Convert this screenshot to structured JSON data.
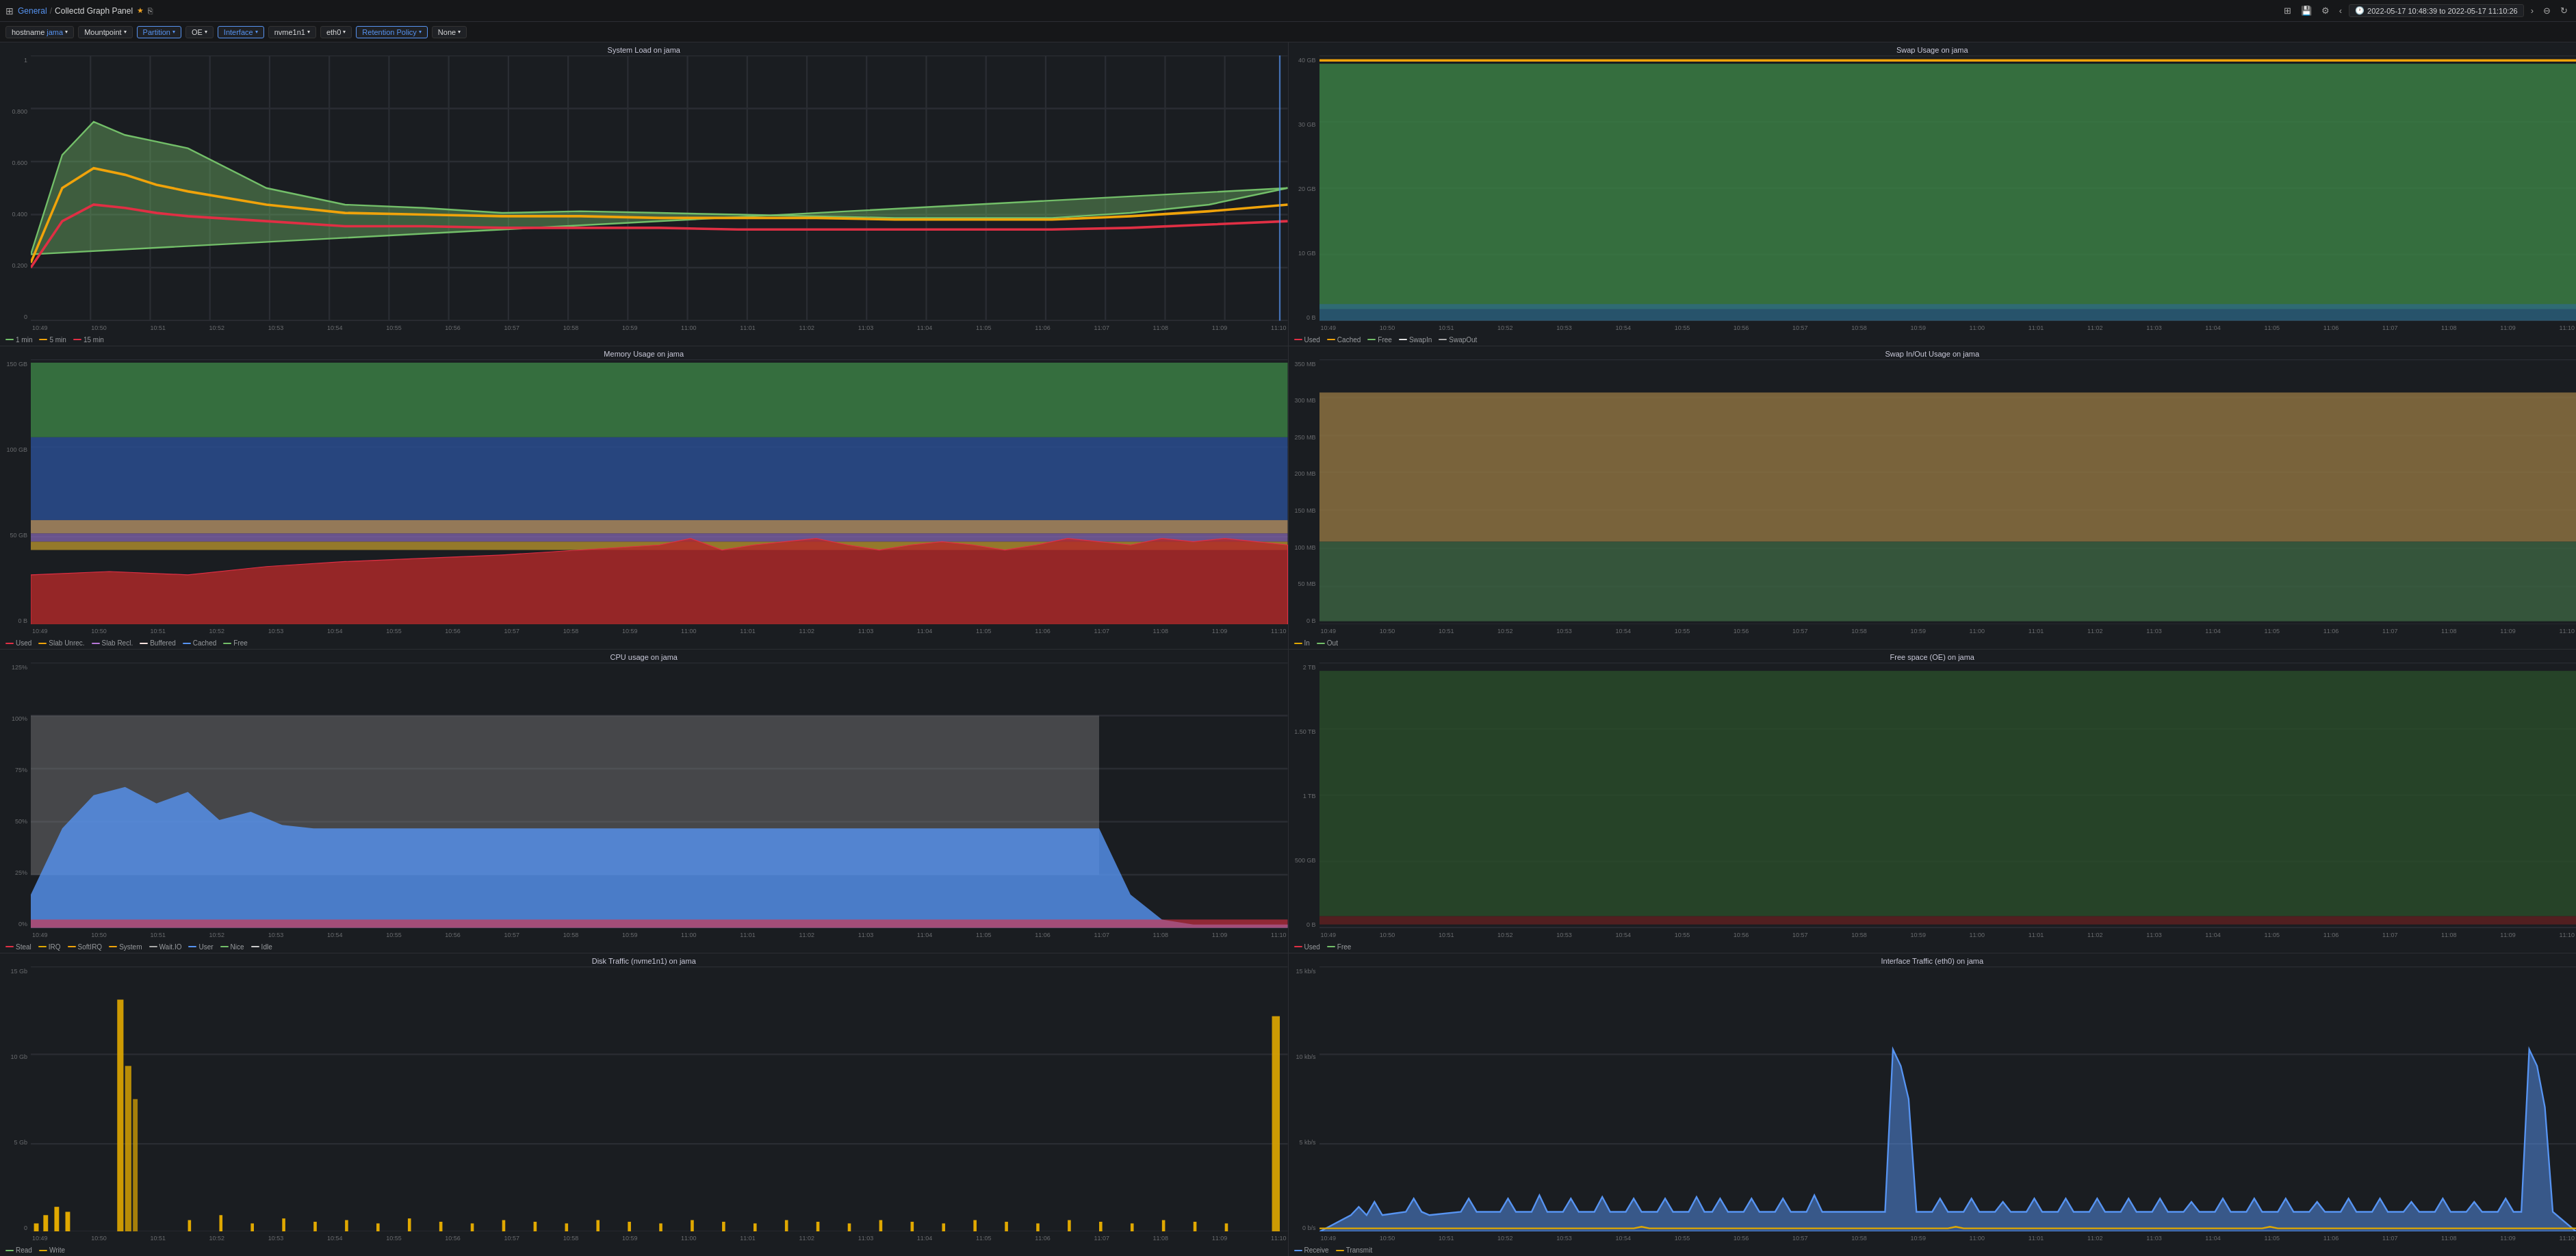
{
  "header": {
    "breadcrumb": [
      "General",
      "Collectd Graph Panel"
    ],
    "star_icon": "★",
    "share_icon": "⎘",
    "dashboard_icon": "⊞",
    "save_icon": "💾",
    "settings_icon": "⚙",
    "time_range": "2022-05-17 10:48:39 to 2022-05-17 11:10:26",
    "zoom_out_icon": "⊖",
    "refresh_icon": "↻",
    "chevron_left": "‹",
    "chevron_right": "›"
  },
  "filters": [
    {
      "label": "hostname",
      "value": "jama",
      "active": true
    },
    {
      "label": "Mountpoint",
      "value": "",
      "active": false
    },
    {
      "label": "Partition",
      "value": "",
      "active": true
    },
    {
      "label": "OE",
      "value": "",
      "active": false
    },
    {
      "label": "Interface",
      "value": "",
      "active": true
    },
    {
      "label": "nvme1n1",
      "value": "",
      "active": false
    },
    {
      "label": "eth0",
      "value": "",
      "active": false
    },
    {
      "label": "Retention Policy",
      "value": "",
      "active": true
    },
    {
      "label": "None",
      "value": "",
      "active": false
    }
  ],
  "panels": [
    {
      "id": "system-load",
      "title": "System Load on jama",
      "position": "top-left",
      "y_labels": [
        "1",
        "0.800",
        "0.600",
        "0.400",
        "0.200",
        "0"
      ],
      "x_labels": [
        "10:49",
        "10:50",
        "10:51",
        "10:52",
        "10:53",
        "10:54",
        "10:55",
        "10:56",
        "10:57",
        "10:58",
        "10:59",
        "11:00",
        "11:01",
        "11:02",
        "11:03",
        "11:04",
        "11:05",
        "11:06",
        "11:07",
        "11:08",
        "11:09",
        "11:10"
      ],
      "legend": [
        {
          "label": "1 min",
          "color": "#73bf69"
        },
        {
          "label": "5 min",
          "color": "#f0a30a"
        },
        {
          "label": "15 min",
          "color": "#e02f44"
        }
      ]
    },
    {
      "id": "swap-usage",
      "title": "Swap Usage on jama",
      "position": "top-right",
      "y_labels": [
        "40 GB",
        "30 GB",
        "20 GB",
        "10 GB",
        "0 B"
      ],
      "x_labels": [
        "10:49",
        "10:50",
        "10:51",
        "10:52",
        "10:53",
        "10:54",
        "10:55",
        "10:56",
        "10:57",
        "10:58",
        "10:59",
        "11:00",
        "11:01",
        "11:02",
        "11:03",
        "11:04",
        "11:05",
        "11:06",
        "11:07",
        "11:08",
        "11:09",
        "11:10"
      ],
      "legend": [
        {
          "label": "Used",
          "color": "#e02f44"
        },
        {
          "label": "Cached",
          "color": "#f0a30a"
        },
        {
          "label": "Free",
          "color": "#73bf69"
        },
        {
          "label": "SwapIn",
          "color": "#e0e0e0"
        },
        {
          "label": "SwapOut",
          "color": "#aaaaaa"
        }
      ]
    },
    {
      "id": "memory-usage",
      "title": "Memory Usage on jama",
      "position": "mid-left",
      "y_labels": [
        "150 GB",
        "100 GB",
        "50 GB",
        "0 B"
      ],
      "x_labels": [
        "10:49",
        "10:50",
        "10:51",
        "10:52",
        "10:53",
        "10:54",
        "10:55",
        "10:56",
        "10:57",
        "10:58",
        "10:59",
        "11:00",
        "11:01",
        "11:02",
        "11:03",
        "11:04",
        "11:05",
        "11:06",
        "11:07",
        "11:08",
        "11:09",
        "11:10"
      ],
      "legend": [
        {
          "label": "Used",
          "color": "#e02f44"
        },
        {
          "label": "Slab Unrec.",
          "color": "#f0a30a"
        },
        {
          "label": "Slab Recl.",
          "color": "#b877d9"
        },
        {
          "label": "Buffered",
          "color": "#fce2de"
        },
        {
          "label": "Cached",
          "color": "#5794f2"
        },
        {
          "label": "Free",
          "color": "#73bf69"
        }
      ]
    },
    {
      "id": "swap-inout",
      "title": "Swap In/Out Usage on jama",
      "position": "mid-right",
      "y_labels": [
        "350 MB",
        "300 MB",
        "250 MB",
        "200 MB",
        "150 MB",
        "100 MB",
        "50 MB",
        "0 B"
      ],
      "x_labels": [
        "10:49",
        "10:50",
        "10:51",
        "10:52",
        "10:53",
        "10:54",
        "10:55",
        "10:56",
        "10:57",
        "10:58",
        "10:59",
        "11:00",
        "11:01",
        "11:02",
        "11:03",
        "11:04",
        "11:05",
        "11:06",
        "11:07",
        "11:08",
        "11:09",
        "11:10"
      ],
      "legend": [
        {
          "label": "In",
          "color": "#e0a800"
        },
        {
          "label": "Out",
          "color": "#73bf69"
        }
      ]
    },
    {
      "id": "cpu-usage",
      "title": "CPU usage on jama",
      "position": "bot-left",
      "y_labels": [
        "125%",
        "100%",
        "75%",
        "50%",
        "25%",
        "0%"
      ],
      "x_labels": [
        "10:49",
        "10:50",
        "10:51",
        "10:52",
        "10:53",
        "10:54",
        "10:55",
        "10:56",
        "10:57",
        "10:58",
        "10:59",
        "11:00",
        "11:01",
        "11:02",
        "11:03",
        "11:04",
        "11:05",
        "11:06",
        "11:07",
        "11:08",
        "11:09",
        "11:10"
      ],
      "legend": [
        {
          "label": "Steal",
          "color": "#e02f44"
        },
        {
          "label": "IRQ",
          "color": "#e0a800"
        },
        {
          "label": "SoftIRQ",
          "color": "#f0a30a"
        },
        {
          "label": "System",
          "color": "#f0a30a"
        },
        {
          "label": "Wait.IO",
          "color": "#aaaaaa"
        },
        {
          "label": "User",
          "color": "#5794f2"
        },
        {
          "label": "Nice",
          "color": "#73bf69"
        },
        {
          "label": "Idle",
          "color": "#cccccc"
        }
      ]
    },
    {
      "id": "free-space",
      "title": "Free space (OE) on jama",
      "position": "bot-right",
      "y_labels": [
        "2 TB",
        "1.50 TB",
        "1 TB",
        "500 GB",
        "0 B"
      ],
      "x_labels": [
        "10:49",
        "10:50",
        "10:51",
        "10:52",
        "10:53",
        "10:54",
        "10:55",
        "10:56",
        "10:57",
        "10:58",
        "10:59",
        "11:00",
        "11:01",
        "11:02",
        "11:03",
        "11:04",
        "11:05",
        "11:06",
        "11:07",
        "11:08",
        "11:09",
        "11:10"
      ],
      "legend": [
        {
          "label": "Used",
          "color": "#e02f44"
        },
        {
          "label": "Free",
          "color": "#73bf69"
        }
      ]
    },
    {
      "id": "disk-traffic",
      "title": "Disk Traffic (nvme1n1) on jama",
      "position": "extra-left",
      "y_labels": [
        "15 Gb",
        "10 Gb",
        "5 Gb",
        "0"
      ],
      "x_labels": [
        "10:49",
        "10:50",
        "10:51",
        "10:52",
        "10:53",
        "10:54",
        "10:55",
        "10:56",
        "10:57",
        "10:58",
        "10:59",
        "11:00",
        "11:01",
        "11:02",
        "11:03",
        "11:04",
        "11:05",
        "11:06",
        "11:07",
        "11:08",
        "11:09",
        "11:10"
      ],
      "legend": [
        {
          "label": "Read",
          "color": "#73bf69"
        },
        {
          "label": "Write",
          "color": "#e0a800"
        }
      ]
    },
    {
      "id": "interface-traffic",
      "title": "Interface Traffic (eth0) on jama",
      "position": "extra-right",
      "y_labels": [
        "15 kb/s",
        "10 kb/s",
        "5 kb/s",
        "0 b/s"
      ],
      "x_labels": [
        "10:49",
        "10:50",
        "10:51",
        "10:52",
        "10:53",
        "10:54",
        "10:55",
        "10:56",
        "10:57",
        "10:58",
        "10:59",
        "11:00",
        "11:01",
        "11:02",
        "11:03",
        "11:04",
        "11:05",
        "11:06",
        "11:07",
        "11:08",
        "11:09",
        "11:10"
      ],
      "legend": [
        {
          "label": "Receive",
          "color": "#5794f2"
        },
        {
          "label": "Transmit",
          "color": "#e0a800"
        }
      ]
    }
  ]
}
